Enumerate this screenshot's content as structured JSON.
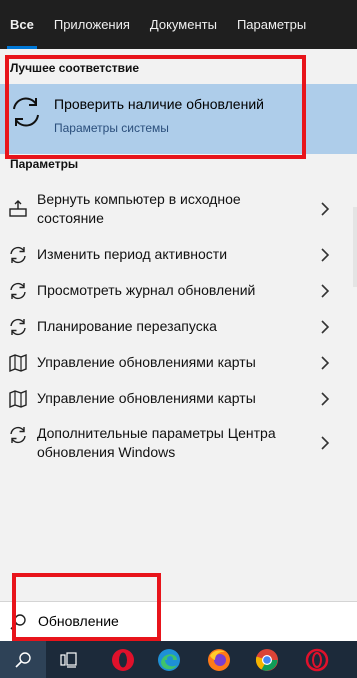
{
  "tabs": [
    {
      "label": "Все",
      "active": true
    },
    {
      "label": "Приложения",
      "active": false
    },
    {
      "label": "Документы",
      "active": false
    },
    {
      "label": "Параметры",
      "active": false
    }
  ],
  "best_match": {
    "section_title": "Лучшее соответствие",
    "title": "Проверить наличие обновлений",
    "subtitle": "Параметры системы",
    "icon": "sync-icon"
  },
  "settings": {
    "section_title": "Параметры",
    "items": [
      {
        "label": "Вернуть компьютер в исходное состояние",
        "icon": "reset-pc-icon"
      },
      {
        "label": "Изменить период активности",
        "icon": "sync-icon"
      },
      {
        "label": "Просмотреть журнал обновлений",
        "icon": "sync-icon"
      },
      {
        "label": "Планирование перезапуска",
        "icon": "sync-icon"
      },
      {
        "label": "Управление обновлениями карты",
        "icon": "map-icon"
      },
      {
        "label": "Управление обновлениями карты",
        "icon": "map-icon"
      },
      {
        "label": "Дополнительные параметры Центра обновления Windows",
        "icon": "sync-icon"
      }
    ]
  },
  "search": {
    "value": "Обновление"
  },
  "taskbar": {
    "items": [
      "search-icon",
      "task-view-icon",
      "opera-icon",
      "edge-icon",
      "firefox-icon",
      "chrome-icon",
      "opera-gx-icon"
    ]
  },
  "colors": {
    "accent": "#0078d7",
    "highlight": "#aecdea",
    "annotation": "#e8141b",
    "taskbar": "#1c2a3a"
  }
}
